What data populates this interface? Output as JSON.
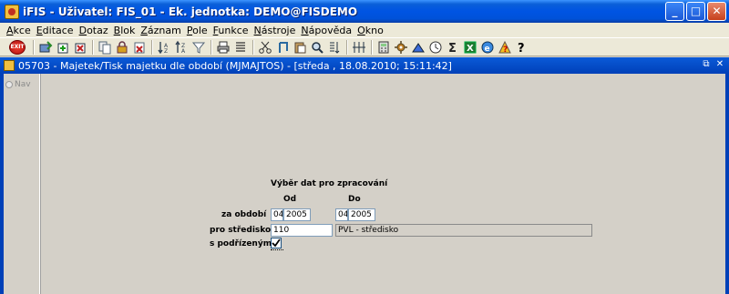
{
  "window": {
    "title": "iFIS - Uživatel: FIS_01 - Ek. jednotka: DEMO@FISDEMO",
    "min": "_",
    "max": "□",
    "close": "✕"
  },
  "menu": [
    "Akce",
    "Editace",
    "Dotaz",
    "Blok",
    "Záznam",
    "Pole",
    "Funkce",
    "Nástroje",
    "Nápověda",
    "Okno"
  ],
  "toolbar": {
    "exit_label": "EXIT",
    "icons": [
      "save-icon",
      "insert-record-icon",
      "delete-record-icon",
      "duplicate-icon",
      "lock-icon",
      "clear-icon",
      "sort-icon",
      "query-icon",
      "filter-icon",
      "print-icon",
      "cut-icon",
      "copy-icon",
      "paste-icon",
      "search-icon",
      "list-icon",
      "columns-icon",
      "calculator-icon",
      "settings-icon",
      "chart-icon",
      "clock-icon",
      "sum-icon",
      "excel-icon",
      "internet-icon",
      "info-icon",
      "help-icon"
    ]
  },
  "inner_window": {
    "title": "05703 - Majetek/Tisk majetku dle období (MJMAJTOS) - [středa , 18.08.2010; 15:11:42]",
    "restore": "⧉",
    "close": "✕"
  },
  "nav": {
    "label": "Nav"
  },
  "form": {
    "heading": "Výběr dat pro zpracování",
    "col_od": "Od",
    "col_do": "Do",
    "za_obdobi_label": "za období",
    "od_month": "04",
    "od_year": "2005",
    "do_month": "04",
    "do_year": "2005",
    "stredisko_label": "pro středisko",
    "stredisko_value": "110",
    "stredisko_name": "PVL - středisko",
    "podrizenymi_label": "s podřízenými",
    "podrizenymi_checked": true
  },
  "colors": {
    "titlebar": "#0054e3",
    "background": "#d4d0c8",
    "menubar": "#ece9d8"
  }
}
